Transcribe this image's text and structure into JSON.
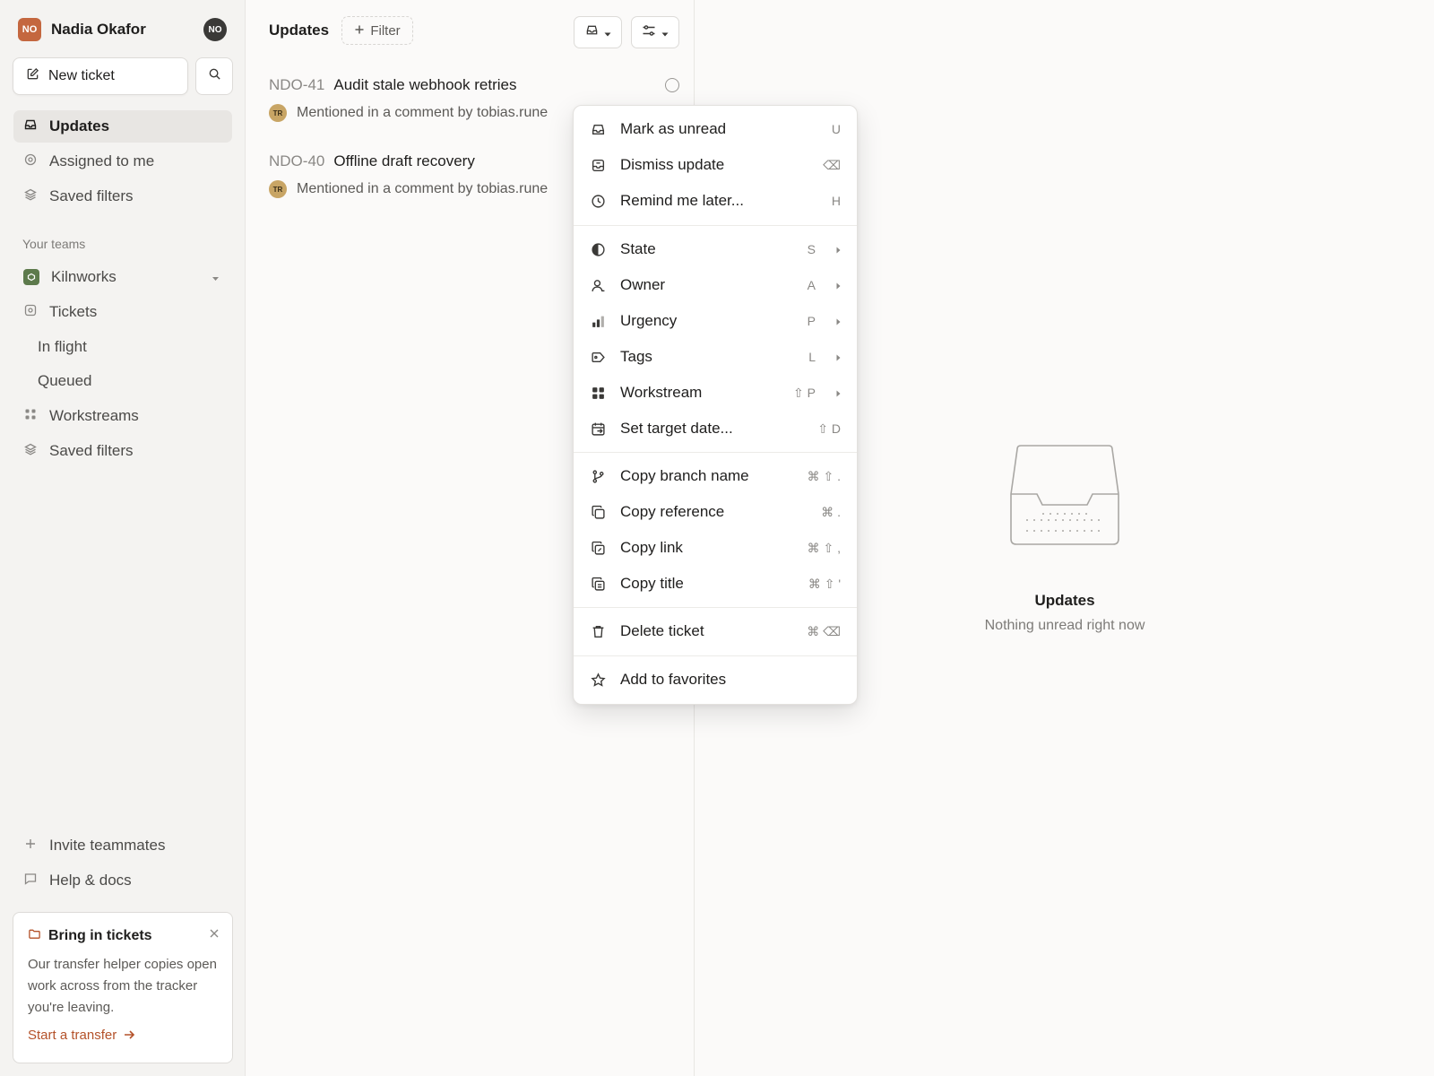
{
  "workspace": {
    "initials": "NO",
    "name": "Nadia Okafor",
    "avatar_initials": "NO"
  },
  "sidebar": {
    "new_ticket_label": "New ticket",
    "nav": [
      {
        "label": "Updates"
      },
      {
        "label": "Assigned to me"
      },
      {
        "label": "Saved filters"
      }
    ],
    "teams_label": "Your teams",
    "team": {
      "name": "Kilnworks"
    },
    "team_items": [
      {
        "label": "Tickets"
      },
      {
        "label": "In flight"
      },
      {
        "label": "Queued"
      },
      {
        "label": "Workstreams"
      },
      {
        "label": "Saved filters"
      }
    ],
    "bottom": [
      {
        "label": "Invite teammates"
      },
      {
        "label": "Help & docs"
      }
    ],
    "promo": {
      "title": "Bring in tickets",
      "body": "Our transfer helper copies open work across from the tracker you're leaving.",
      "link": "Start a transfer"
    }
  },
  "list": {
    "title": "Updates",
    "filter_label": "Filter",
    "rows": [
      {
        "id": "NDO-41",
        "title": "Audit stale webhook retries",
        "avatar": "TR",
        "detail": "Mentioned in a comment by tobias.rune"
      },
      {
        "id": "NDO-40",
        "title": "Offline draft recovery",
        "avatar": "TR",
        "detail": "Mentioned in a comment by tobias.rune"
      }
    ]
  },
  "detail": {
    "empty_title": "Updates",
    "empty_subtitle": "Nothing unread right now"
  },
  "menu": {
    "items": [
      {
        "label": "Mark as unread",
        "shortcut": "U"
      },
      {
        "label": "Dismiss update",
        "shortcut": "⌫"
      },
      {
        "label": "Remind me later...",
        "shortcut": "H"
      },
      {
        "label": "State",
        "shortcut": "S"
      },
      {
        "label": "Owner",
        "shortcut": "A"
      },
      {
        "label": "Urgency",
        "shortcut": "P"
      },
      {
        "label": "Tags",
        "shortcut": "L"
      },
      {
        "label": "Workstream",
        "shortcut": "⇧ P"
      },
      {
        "label": "Set target date...",
        "shortcut": "⇧ D"
      },
      {
        "label": "Copy branch name",
        "shortcut": "⌘ ⇧ ."
      },
      {
        "label": "Copy reference",
        "shortcut": "⌘ ."
      },
      {
        "label": "Copy link",
        "shortcut": "⌘ ⇧ ,"
      },
      {
        "label": "Copy title",
        "shortcut": "⌘ ⇧ '"
      },
      {
        "label": "Delete ticket",
        "shortcut": "⌘ ⌫"
      },
      {
        "label": "Add to favorites",
        "shortcut": ""
      }
    ]
  },
  "colors": {
    "accent": "#b4522a",
    "workspace_badge": "#c4673f",
    "team_chip": "#5d7a4c"
  }
}
